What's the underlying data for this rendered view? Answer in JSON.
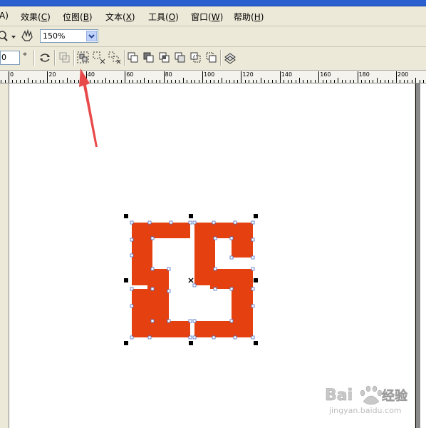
{
  "menu": {
    "items": [
      {
        "label": "A)",
        "underline": ""
      },
      {
        "label": "效果(",
        "underline": "C",
        "suffix": ")"
      },
      {
        "label": "位图(",
        "underline": "B",
        "suffix": ")"
      },
      {
        "label": "文本(",
        "underline": "X",
        "suffix": ")"
      },
      {
        "label": "工具(",
        "underline": "O",
        "suffix": ")"
      },
      {
        "label": "窗口(",
        "underline": "W",
        "suffix": ")"
      },
      {
        "label": "帮助(",
        "underline": "H",
        "suffix": ")"
      }
    ]
  },
  "toolbar": {
    "zoom_value": "150%",
    "angle_value": "0",
    "angle_unit": "°"
  },
  "ruler": {
    "labels": [
      "0",
      "20",
      "40",
      "60",
      "80",
      "100",
      "120",
      "140",
      "160",
      "180",
      "200"
    ]
  },
  "colors": {
    "logo_fill": "#e5400f",
    "arrow": "#e84a4a",
    "titlebar": "#2a5fcf"
  },
  "watermark": {
    "brand": "Bai",
    "brand2": "经验",
    "url": "jingyan.baidu.com"
  }
}
